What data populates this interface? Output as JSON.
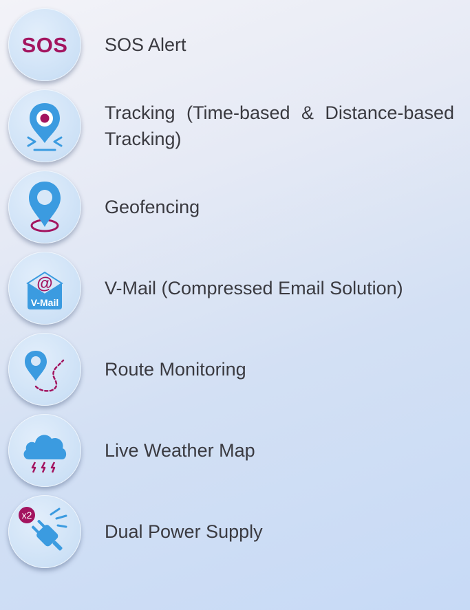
{
  "colors": {
    "accent_blue": "#3b9be0",
    "accent_magenta": "#a3145f",
    "text": "#3a3a40"
  },
  "features": [
    {
      "icon": "sos-icon",
      "badge_text": "SOS",
      "label": "SOS Alert"
    },
    {
      "icon": "tracking-pin-icon",
      "label": "Tracking (Time-based & Distance-based Tracking)"
    },
    {
      "icon": "geofence-pin-icon",
      "label": "Geofencing"
    },
    {
      "icon": "vmail-icon",
      "badge_symbol": "@",
      "badge_text": "V-Mail",
      "label": "V-Mail (Compressed Email Solution)"
    },
    {
      "icon": "route-icon",
      "label": "Route Monitoring"
    },
    {
      "icon": "weather-cloud-icon",
      "label": "Live Weather Map"
    },
    {
      "icon": "power-plug-icon",
      "badge_text": "x2",
      "label": "Dual Power Supply"
    }
  ]
}
